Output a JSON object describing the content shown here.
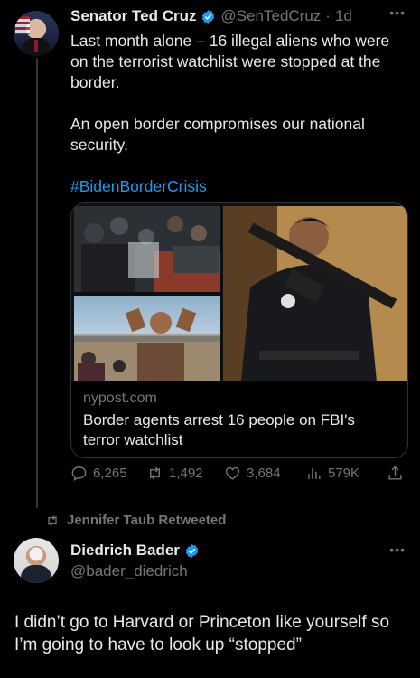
{
  "tweet1": {
    "name": "Senator Ted Cruz",
    "handle": "@SenTedCruz",
    "separator": "·",
    "time": "1d",
    "text_p1": "Last month alone – 16 illegal aliens who were on the terrorist watchlist were stopped at the border.",
    "text_p2": "An open border compromises our national security.",
    "hashtag": "#BidenBorderCrisis",
    "card": {
      "domain": "nypost.com",
      "title": "Border agents arrest 16 people on FBI's terror watchlist"
    },
    "actions": {
      "replies": "6,265",
      "retweets": "1,492",
      "likes": "3,684",
      "views": "579K"
    }
  },
  "retweet_label": "Jennifer Taub Retweeted",
  "tweet2": {
    "name": "Diedrich Bader",
    "handle": "@bader_diedrich",
    "text": "I didn’t go to Harvard or Princeton like yourself so I’m going to have to look up “stopped”"
  },
  "colors": {
    "background": "#000000",
    "text": "#e7e9ea",
    "secondary": "#71767b",
    "accent": "#1d9bf0",
    "border": "#2f3336"
  },
  "icons": [
    "verified-badge-icon",
    "more-icon",
    "reply-icon",
    "retweet-icon",
    "like-icon",
    "views-icon",
    "share-icon"
  ]
}
